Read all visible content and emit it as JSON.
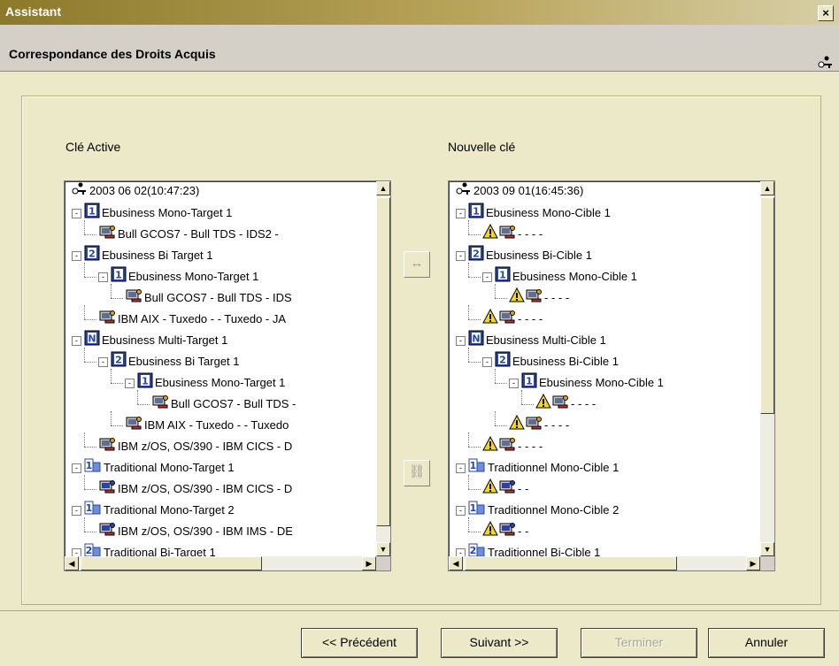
{
  "window": {
    "title": "Assistant",
    "close_label": "×"
  },
  "header": {
    "title": "Correspondance des Droits Acquis"
  },
  "left": {
    "label": "Clé Active",
    "rows": [
      {
        "level": 0,
        "icon": "key",
        "text": "2003 06 02(10:47:23)"
      },
      {
        "level": 0,
        "icon": "badge-1",
        "exp": "-",
        "text": "Ebusiness Mono-Target 1"
      },
      {
        "level": 1,
        "icon": "server",
        "text": "Bull GCOS7 - Bull TDS - IDS2 -"
      },
      {
        "level": 0,
        "icon": "badge-2",
        "exp": "-",
        "text": "Ebusiness Bi Target 1"
      },
      {
        "level": 1,
        "icon": "badge-1",
        "exp": "-",
        "text": "Ebusiness Mono-Target 1"
      },
      {
        "level": 2,
        "icon": "server",
        "text": "Bull GCOS7 - Bull TDS - IDS"
      },
      {
        "level": 1,
        "icon": "server",
        "text": "IBM AIX - Tuxedo -  - Tuxedo - JA"
      },
      {
        "level": 0,
        "icon": "badge-n",
        "exp": "-",
        "text": "Ebusiness Multi-Target 1"
      },
      {
        "level": 1,
        "icon": "badge-2",
        "exp": "-",
        "text": "Ebusiness Bi Target 1"
      },
      {
        "level": 2,
        "icon": "badge-1",
        "exp": "-",
        "text": "Ebusiness Mono-Target 1"
      },
      {
        "level": 3,
        "icon": "server",
        "text": "Bull GCOS7 - Bull TDS -"
      },
      {
        "level": 2,
        "icon": "server",
        "text": "IBM AIX - Tuxedo -  - Tuxedo"
      },
      {
        "level": 1,
        "icon": "server",
        "text": "IBM z/OS, OS/390 - IBM CICS - D"
      },
      {
        "level": 0,
        "icon": "trad-1",
        "exp": "-",
        "text": "Traditional Mono-Target 1"
      },
      {
        "level": 1,
        "icon": "server2",
        "text": "IBM z/OS, OS/390 - IBM CICS - D"
      },
      {
        "level": 0,
        "icon": "trad-1",
        "exp": "-",
        "text": "Traditional Mono-Target 2"
      },
      {
        "level": 1,
        "icon": "server2",
        "text": "IBM z/OS, OS/390 - IBM IMS - DE"
      },
      {
        "level": 0,
        "icon": "trad-2",
        "exp": "-",
        "text": "Traditional Bi-Target 1"
      }
    ]
  },
  "right": {
    "label": "Nouvelle clé",
    "rows": [
      {
        "level": 0,
        "icon": "key",
        "text": "2003 09 01(16:45:36)"
      },
      {
        "level": 0,
        "icon": "badge-1",
        "exp": "-",
        "text": "Ebusiness Mono-Cible 1"
      },
      {
        "level": 1,
        "icon": "warn-server",
        "text": "- - - -"
      },
      {
        "level": 0,
        "icon": "badge-2",
        "exp": "-",
        "text": "Ebusiness Bi-Cible 1"
      },
      {
        "level": 1,
        "icon": "badge-1",
        "exp": "-",
        "text": "Ebusiness Mono-Cible 1"
      },
      {
        "level": 2,
        "icon": "warn-server",
        "text": "- - - -"
      },
      {
        "level": 1,
        "icon": "warn-server",
        "text": "- - - -"
      },
      {
        "level": 0,
        "icon": "badge-n",
        "exp": "-",
        "text": "Ebusiness Multi-Cible 1"
      },
      {
        "level": 1,
        "icon": "badge-2",
        "exp": "-",
        "text": "Ebusiness Bi-Cible 1"
      },
      {
        "level": 2,
        "icon": "badge-1",
        "exp": "-",
        "text": "Ebusiness Mono-Cible 1"
      },
      {
        "level": 3,
        "icon": "warn-server",
        "text": "- - - -"
      },
      {
        "level": 2,
        "icon": "warn-server",
        "text": "- - - -"
      },
      {
        "level": 1,
        "icon": "warn-server",
        "text": "- - - -"
      },
      {
        "level": 0,
        "icon": "trad-1",
        "exp": "-",
        "text": "Traditionnel Mono-Cible 1"
      },
      {
        "level": 1,
        "icon": "warn-server2",
        "text": "- -"
      },
      {
        "level": 0,
        "icon": "trad-1",
        "exp": "-",
        "text": "Traditionnel Mono-Cible 2"
      },
      {
        "level": 1,
        "icon": "warn-server2",
        "text": "- -"
      },
      {
        "level": 0,
        "icon": "trad-2",
        "exp": "-",
        "text": "Traditionnel Bi-Cible 1"
      }
    ]
  },
  "middle": {
    "map_label": "↔",
    "link_label": "⛓"
  },
  "buttons": {
    "previous": "<< Précédent",
    "next": "Suivant >>",
    "finish": "Terminer",
    "cancel": "Annuler"
  },
  "colors": {
    "titlebar": "#8C7A2A",
    "badge": "#2546A8",
    "warn": "#F5D80F"
  }
}
